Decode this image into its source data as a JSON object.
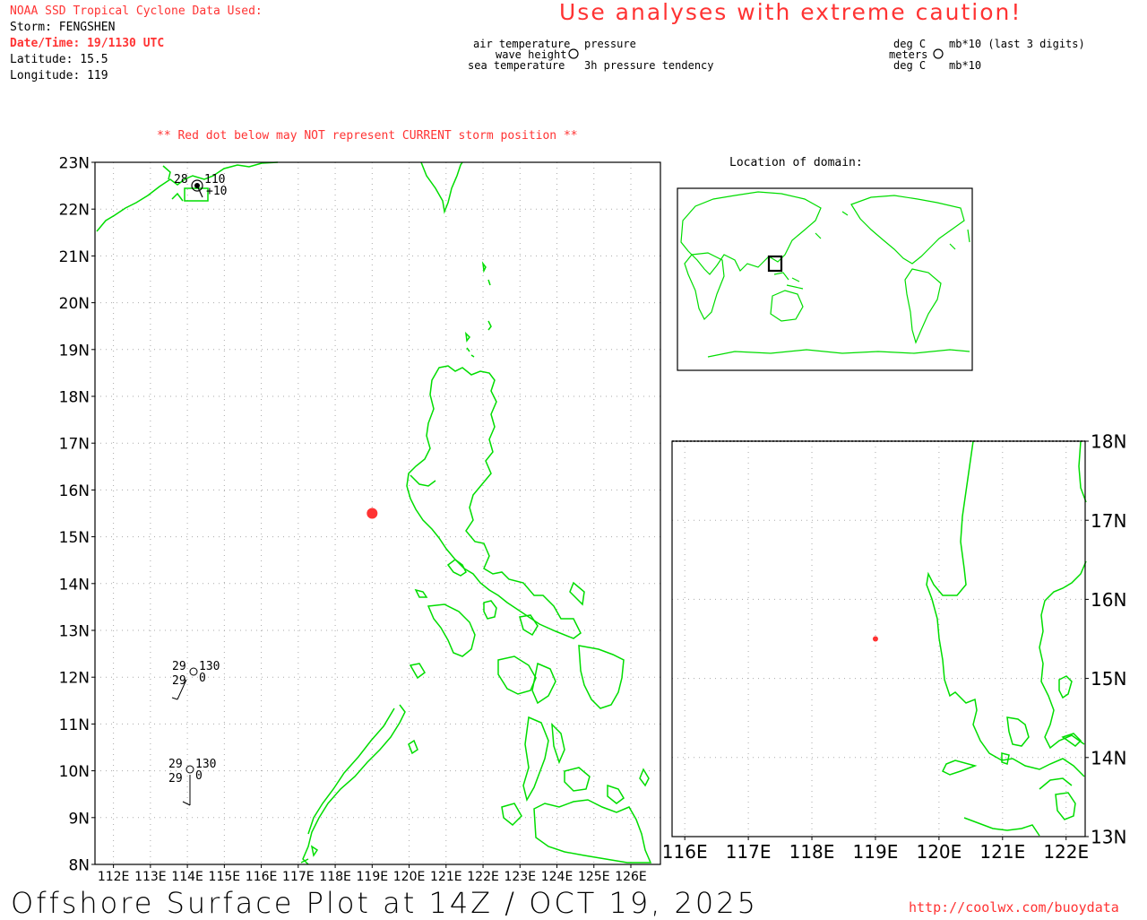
{
  "header": {
    "source_label": "NOAA SSD Tropical Cyclone Data Used:",
    "storm": "Storm: FENGSHEN",
    "datetime": "Date/Time: 19/1130 UTC",
    "latitude": "Latitude: 15.5",
    "longitude": "Longitude: 119",
    "caution": "Use analyses with extreme caution!"
  },
  "legend": {
    "left": {
      "air_temperature": "air temperature",
      "wave_height": "wave height",
      "sea_temperature": "sea temperature",
      "pressure": "pressure",
      "pressure_tendency": "3h pressure tendency"
    },
    "right": {
      "deg_c_top": "deg C",
      "meters": "meters",
      "deg_c_bottom": "deg C",
      "mb_last3": "mb*10 (last 3 digits)",
      "mb": "mb*10"
    }
  },
  "notice": "** Red dot below may NOT represent CURRENT storm position **",
  "inset_title": "Location of domain:",
  "main_map": {
    "lat_labels": [
      "23N",
      "22N",
      "21N",
      "20N",
      "19N",
      "18N",
      "17N",
      "16N",
      "15N",
      "14N",
      "13N",
      "12N",
      "11N",
      "10N",
      "9N",
      "8N"
    ],
    "lon_labels": [
      "112E",
      "113E",
      "114E",
      "115E",
      "116E",
      "117E",
      "118E",
      "119E",
      "120E",
      "121E",
      "122E",
      "123E",
      "124E",
      "125E",
      "126E"
    ],
    "lat_range": [
      8,
      23
    ],
    "lon_range": [
      111.5,
      126.8
    ],
    "storm_position": {
      "lat": 15.5,
      "lon": 119
    },
    "stations": [
      {
        "lat": 22.5,
        "lon": 114.2,
        "air_temp": "28",
        "pressure": "110",
        "tendency": "+10"
      },
      {
        "lat": 12.1,
        "lon": 114.1,
        "air_temp": "29",
        "pressure": "130",
        "sea_temp": "29",
        "tendency": "0"
      },
      {
        "lat": 10.0,
        "lon": 114.0,
        "air_temp": "29",
        "pressure": "130",
        "sea_temp": "29",
        "tendency": "0"
      }
    ]
  },
  "zoom_map": {
    "lat_labels": [
      "18N",
      "17N",
      "16N",
      "15N",
      "14N",
      "13N"
    ],
    "lon_labels": [
      "116E",
      "117E",
      "118E",
      "119E",
      "120E",
      "121E",
      "122E"
    ],
    "lat_range": [
      13,
      18
    ],
    "lon_range": [
      115.8,
      122.3
    ],
    "storm_position": {
      "lat": 15.5,
      "lon": 119
    }
  },
  "footer": {
    "title": "Offshore Surface Plot at 14Z / OCT 19, 2025",
    "url": "http://coolwx.com/buoydata"
  },
  "colors": {
    "coastline": "#00dd00",
    "storm_dot": "#ff3333",
    "text_red": "#ff3333",
    "grid": "#aaaaaa"
  }
}
